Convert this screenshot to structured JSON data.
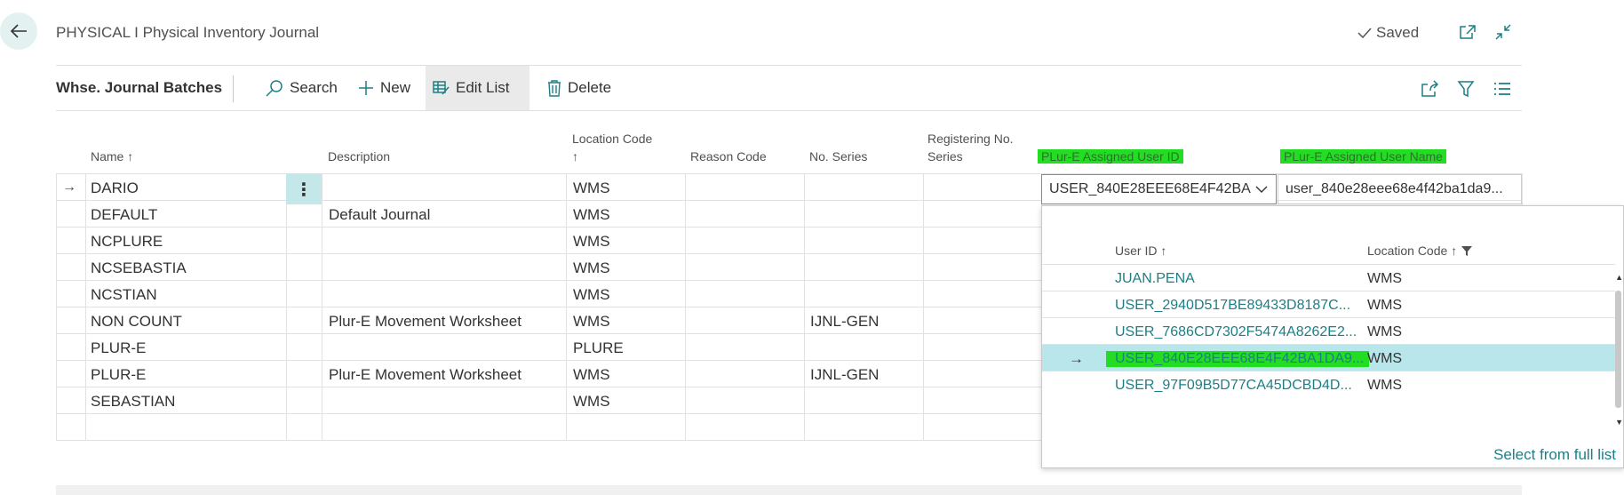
{
  "header": {
    "title": "PHYSICAL I Physical Inventory Journal",
    "saved_label": "Saved"
  },
  "toolbar": {
    "title": "Whse. Journal Batches",
    "search": "Search",
    "new": "New",
    "edit_list": "Edit List",
    "delete": "Delete"
  },
  "columns": {
    "name": "Name",
    "description": "Description",
    "location_code": "Location Code",
    "reason_code": "Reason Code",
    "no_series": "No. Series",
    "registering_no_series": "Registering No. Series",
    "assigned_user_id": "PLur-E Assigned User ID",
    "assigned_user_name": "PLur-E Assigned User Name"
  },
  "rows": [
    {
      "name": "DARIO",
      "description": "",
      "location": "WMS",
      "reason": "",
      "no_series": "",
      "reg_series": ""
    },
    {
      "name": "DEFAULT",
      "description": "Default Journal",
      "location": "WMS",
      "reason": "",
      "no_series": "",
      "reg_series": ""
    },
    {
      "name": "NCPLURE",
      "description": "",
      "location": "WMS",
      "reason": "",
      "no_series": "",
      "reg_series": ""
    },
    {
      "name": "NCSEBASTIA",
      "description": "",
      "location": "WMS",
      "reason": "",
      "no_series": "",
      "reg_series": ""
    },
    {
      "name": "NCSTIAN",
      "description": "",
      "location": "WMS",
      "reason": "",
      "no_series": "",
      "reg_series": ""
    },
    {
      "name": "NON COUNT",
      "description": "Plur-E Movement Worksheet",
      "location": "WMS",
      "reason": "",
      "no_series": "IJNL-GEN",
      "reg_series": ""
    },
    {
      "name": "PLUR-E",
      "description": "",
      "location": "PLURE",
      "reason": "",
      "no_series": "",
      "reg_series": ""
    },
    {
      "name": "PLUR-E",
      "description": "Plur-E Movement Worksheet",
      "location": "WMS",
      "reason": "",
      "no_series": "IJNL-GEN",
      "reg_series": ""
    },
    {
      "name": "SEBASTIAN",
      "description": "",
      "location": "WMS",
      "reason": "",
      "no_series": "",
      "reg_series": ""
    }
  ],
  "current_row": {
    "user_id_value": "USER_840E28EEE68E4F42BA",
    "user_name_value": "user_840e28eee68e4f42ba1da9..."
  },
  "dropdown": {
    "col_user_id": "User ID",
    "col_location": "Location Code",
    "items": [
      {
        "user_id": "JUAN.PENA",
        "location": "WMS"
      },
      {
        "user_id": "USER_2940D517BE89433D8187C...",
        "location": "WMS"
      },
      {
        "user_id": "USER_7686CD7302F5474A8262E2...",
        "location": "WMS"
      },
      {
        "user_id": "USER_840E28EEE68E4F42BA1DA9...",
        "location": "WMS"
      },
      {
        "user_id": "USER_97F09B5D77CA45DCBD4D...",
        "location": "WMS"
      }
    ],
    "footer": "Select from full list"
  },
  "colors": {
    "accent": "#1d7f85",
    "highlight": "#22dd22",
    "selected_row": "#b9e6ea"
  }
}
